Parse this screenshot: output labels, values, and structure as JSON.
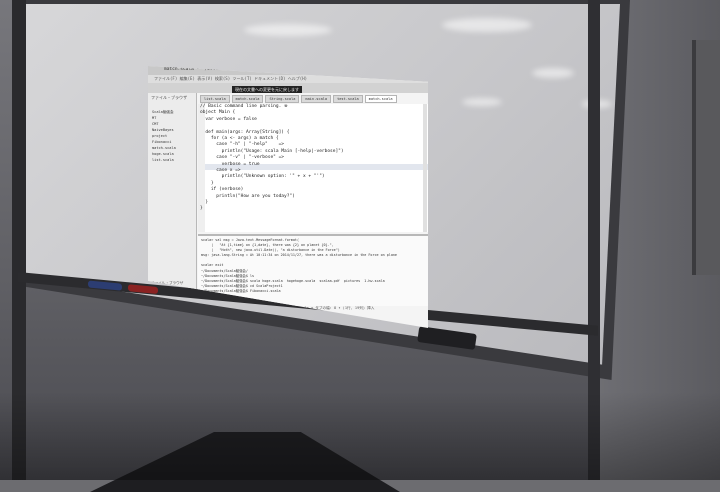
{
  "window": {
    "title": "match.scala - ~/Documents/Scala勉強会/ScalaProject1 - gedit"
  },
  "menu": "ファイル(F) 編集(E) 表示(V) 検索(S) ツール(T) ドキュメント(D) ヘルプ(H)",
  "toolbar": {
    "tooltip": "現在の文書への変更を元に戻します"
  },
  "sidebar": {
    "title": "ファイル・ブラウザ",
    "items": [
      "Scala勉強会",
      "MT",
      "CMT",
      "NaiveBayes",
      "project",
      "Fibonacci",
      "match.scala",
      "hoge.scala",
      "list.scala"
    ],
    "footer": "ファイル・ブラウザ"
  },
  "tabs": [
    {
      "label": "list.scala"
    },
    {
      "label": "match.scala"
    },
    {
      "label": "String.scala"
    },
    {
      "label": "main.scala"
    },
    {
      "label": "test.scala"
    },
    {
      "label": "match.scala"
    }
  ],
  "editor": {
    "lines": [
      "// Basic command line parsing. ※",
      "object Main {",
      "  var verbose = false",
      "",
      "  def main(args: Array[String]) {",
      "    for (a <- args) a match {",
      "      case \"-h\" | \"-help\"    =>",
      "        println(\"Usage: scala Main [-help|-verbose]\")",
      "      case \"-v\" | \"-verbose\" =>",
      "        verbose = true",
      "      case x =>",
      "        println(\"Unknown option: '\" + x + \"'\")",
      "    }",
      "    if (verbose)",
      "      println(\"How are you today?\")",
      "  }",
      "}"
    ]
  },
  "console": {
    "lines": [
      "scala> val msg = Java.text.MessageFormat.format(",
      "     |   \"At {1,time} on {1,date}, there was {2} on planet {0}.\",",
      "     |   \"Hoth\", new java.util.Date(), \"a disturbance in the Force\")",
      "msg: java.lang.String = At 10:11:34 on 2014/11/27, there was a disturbance in the Force on plane",
      "",
      "scala> exit",
      "~/Documents/Scala勉強会/",
      "~/Documents/Scala勉強会$ ls",
      "~/Documents/Scala勉強会$ scala hoge.scala  hogehoge.scala  scalaa.pdf  pictures  1-hw.scala",
      "~/Documents/Scala勉強会$ cd ScalaProject1",
      "~/Documents/Scala勉強会$ Fibonacci.scala"
    ]
  },
  "status_bar": "Scala ▾   タブの幅: 8 ▾   (1行, 19列)   挿入"
}
